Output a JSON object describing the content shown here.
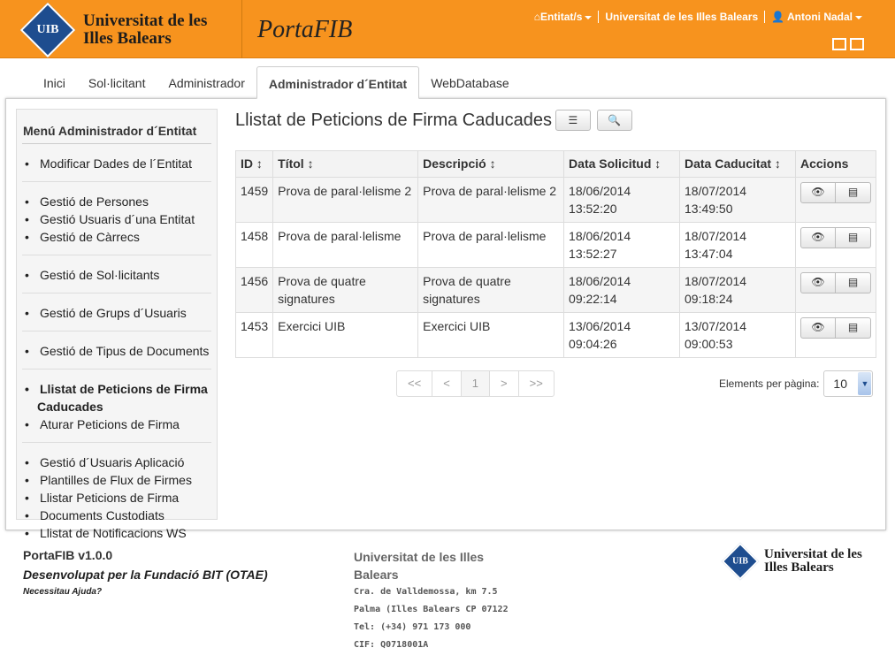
{
  "header": {
    "university_name_line1": "Universitat de les",
    "university_name_line2": "Illes Balears",
    "logo_abbr": "UIB",
    "app_logo": "PortaFIB",
    "nav": {
      "entitats_label": "Entitat/s",
      "entity_name": "Universitat de les Illes Balears",
      "user_name": "Antoni Nadal"
    },
    "accent_color": "#f7931e"
  },
  "tabs": [
    {
      "label": "Inici"
    },
    {
      "label": "Sol·licitant"
    },
    {
      "label": "Administrador"
    },
    {
      "label": "Administrador d´Entitat"
    },
    {
      "label": "WebDatabase"
    }
  ],
  "sidebar": {
    "title": "Menú Administrador d´Entitat",
    "groups": [
      [
        "Modificar Dades de l´Entitat"
      ],
      [
        "Gestió de Persones",
        "Gestió Usuaris d´una Entitat",
        "Gestió de Càrrecs"
      ],
      [
        "Gestió de Sol·licitants"
      ],
      [
        "Gestió de Grups d´Usuaris"
      ],
      [
        "Gestió de Tipus de Documents"
      ],
      [
        "Llistat de Peticions de Firma Caducades",
        "Aturar Peticions de Firma"
      ],
      [
        "Gestió d´Usuaris Aplicació",
        "Plantilles de Flux de Firmes",
        "Llistar Peticions de Firma",
        "Documents Custodiats",
        "Llistat de Notificacions WS"
      ]
    ]
  },
  "main": {
    "title": "Llistat de Peticions de Firma Caducades",
    "columns": [
      "ID",
      "Títol",
      "Descripció",
      "Data Solicitud",
      "Data Caducitat",
      "Accions"
    ],
    "rows": [
      {
        "id": "1459",
        "titol": "Prova de paral·lelisme 2",
        "descripcio": "Prova de paral·lelisme 2",
        "solicitud_date": "18/06/2014",
        "solicitud_time": "13:52:20",
        "caducitat_date": "18/07/2014",
        "caducitat_time": "13:49:50"
      },
      {
        "id": "1458",
        "titol": "Prova de paral·lelisme",
        "descripcio": "Prova de paral·lelisme",
        "solicitud_date": "18/06/2014",
        "solicitud_time": "13:52:27",
        "caducitat_date": "18/07/2014",
        "caducitat_time": "13:47:04"
      },
      {
        "id": "1456",
        "titol": "Prova de quatre signatures",
        "descripcio": "Prova de quatre signatures",
        "solicitud_date": "18/06/2014",
        "solicitud_time": "09:22:14",
        "caducitat_date": "18/07/2014",
        "caducitat_time": "09:18:24"
      },
      {
        "id": "1453",
        "titol": "Exercici UIB",
        "descripcio": "Exercici UIB",
        "solicitud_date": "13/06/2014",
        "solicitud_time": "09:04:26",
        "caducitat_date": "13/07/2014",
        "caducitat_time": "09:00:53"
      }
    ],
    "pager": [
      "<<",
      "<",
      "1",
      ">",
      ">>"
    ],
    "per_page_label": "Elements per pàgina:",
    "per_page_value": "10"
  },
  "footer": {
    "version": "PortaFIB v1.0.0",
    "developed_by": "Desenvolupat per la Fundació BIT (OTAE)",
    "help": "Necessitau Ajuda?",
    "uni_name": "Universitat de les Illes Balears",
    "address1": "Cra. de Valldemossa, km 7.5",
    "address2": "Palma (Illes Balears CP 07122",
    "phone": "Tel: (+34) 971 173 000",
    "cif": "CIF: Q0718001A",
    "logo_line1": "Universitat de les",
    "logo_line2": "Illes Balears",
    "logo_abbr": "UIB"
  }
}
